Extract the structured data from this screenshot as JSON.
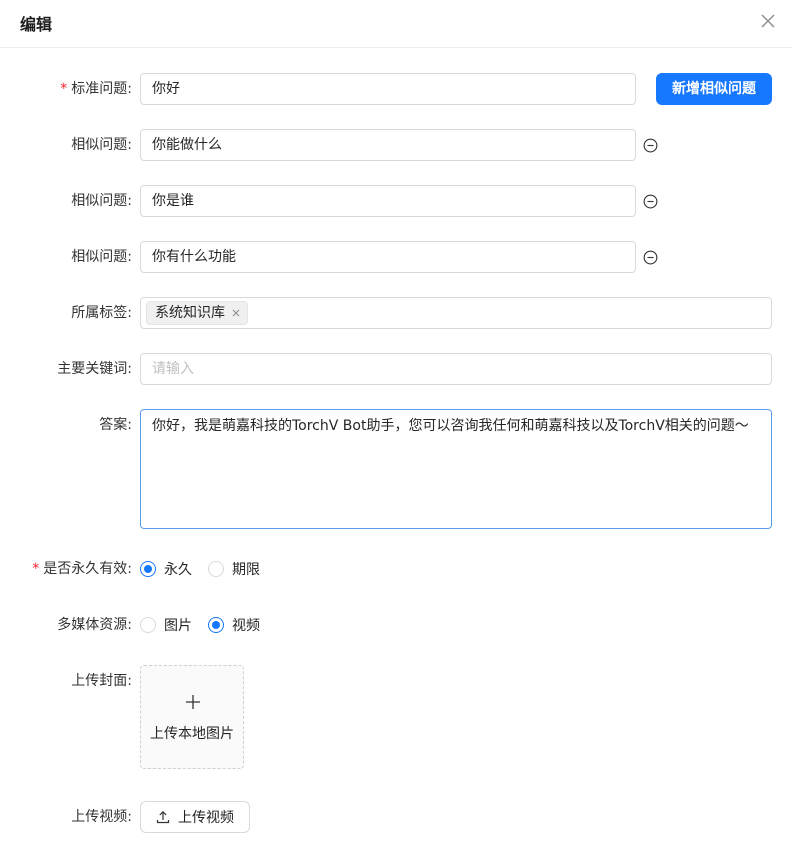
{
  "dialog": {
    "title": "编辑"
  },
  "form": {
    "standard_question": {
      "label": "标准问题:",
      "value": "你好",
      "required": true
    },
    "add_similar_button": "新增相似问题",
    "similar_questions": [
      {
        "label": "相似问题:",
        "value": "你能做什么"
      },
      {
        "label": "相似问题:",
        "value": "你是谁"
      },
      {
        "label": "相似问题:",
        "value": "你有什么功能"
      }
    ],
    "tags": {
      "label": "所属标签:",
      "items": [
        "系统知识库"
      ]
    },
    "keywords": {
      "label": "主要关键词:",
      "placeholder": "请输入"
    },
    "answer": {
      "label": "答案:",
      "value": "你好，我是萌嘉科技的TorchV Bot助手，您可以咨询我任何和萌嘉科技以及TorchV相关的问题～"
    },
    "permanent": {
      "label": "是否永久有效:",
      "required": true,
      "options": [
        "永久",
        "期限"
      ],
      "selected": "永久"
    },
    "media": {
      "label": "多媒体资源:",
      "options": [
        "图片",
        "视频"
      ],
      "selected": "视频"
    },
    "cover": {
      "label": "上传封面:",
      "button_text": "上传本地图片"
    },
    "video": {
      "label": "上传视频:",
      "button_text": "上传视频"
    }
  },
  "colors": {
    "primary": "#1677ff",
    "required": "#f5222d"
  },
  "icons": {
    "close": "close-icon",
    "minus": "minus-circle-icon",
    "plus": "plus-icon",
    "upload": "upload-icon"
  }
}
